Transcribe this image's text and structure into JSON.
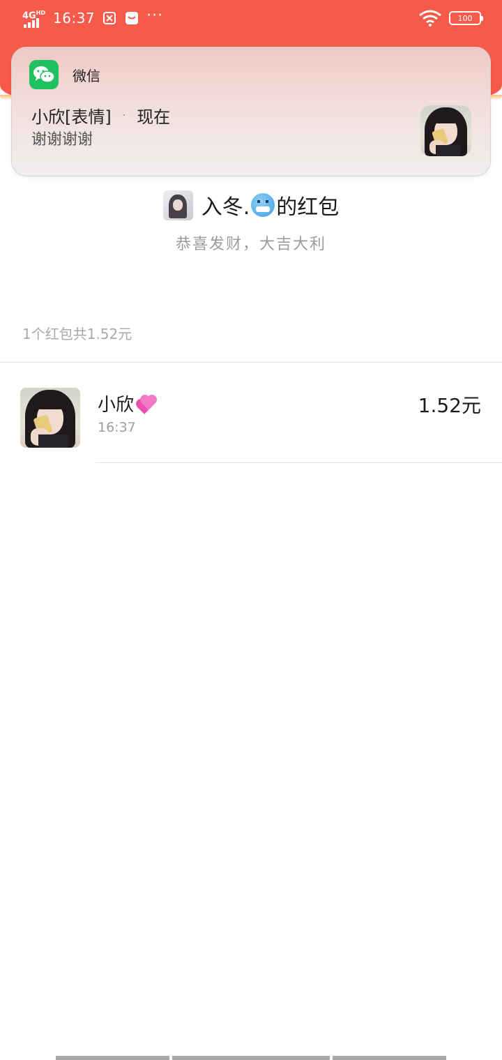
{
  "status_bar": {
    "network": "4G",
    "network_badge": "HD",
    "time": "16:37",
    "battery": "100",
    "icons": [
      "signal-icon",
      "alarm-icon",
      "message-icon",
      "more-icon",
      "wifi-icon",
      "battery-icon"
    ],
    "more": "···"
  },
  "notification": {
    "app_name": "微信",
    "app_icon": "wechat-icon",
    "sender": "小欣[表情]",
    "separator": "·",
    "time": "现在",
    "message": "谢谢谢谢"
  },
  "red_packet": {
    "title_prefix": "入冬.",
    "title_emoji": "freezing-face-emoji",
    "title_suffix": "的红包",
    "greeting": "恭喜发财，大吉大利",
    "summary": "1个红包共1.52元"
  },
  "records": [
    {
      "name": "小欣",
      "name_emoji": "two-hearts-emoji",
      "time": "16:37",
      "amount": "1.52元"
    }
  ],
  "colors": {
    "header_red": "#f55a4a",
    "wechat_green": "#1fc060",
    "muted_text": "#9b9b9b"
  }
}
